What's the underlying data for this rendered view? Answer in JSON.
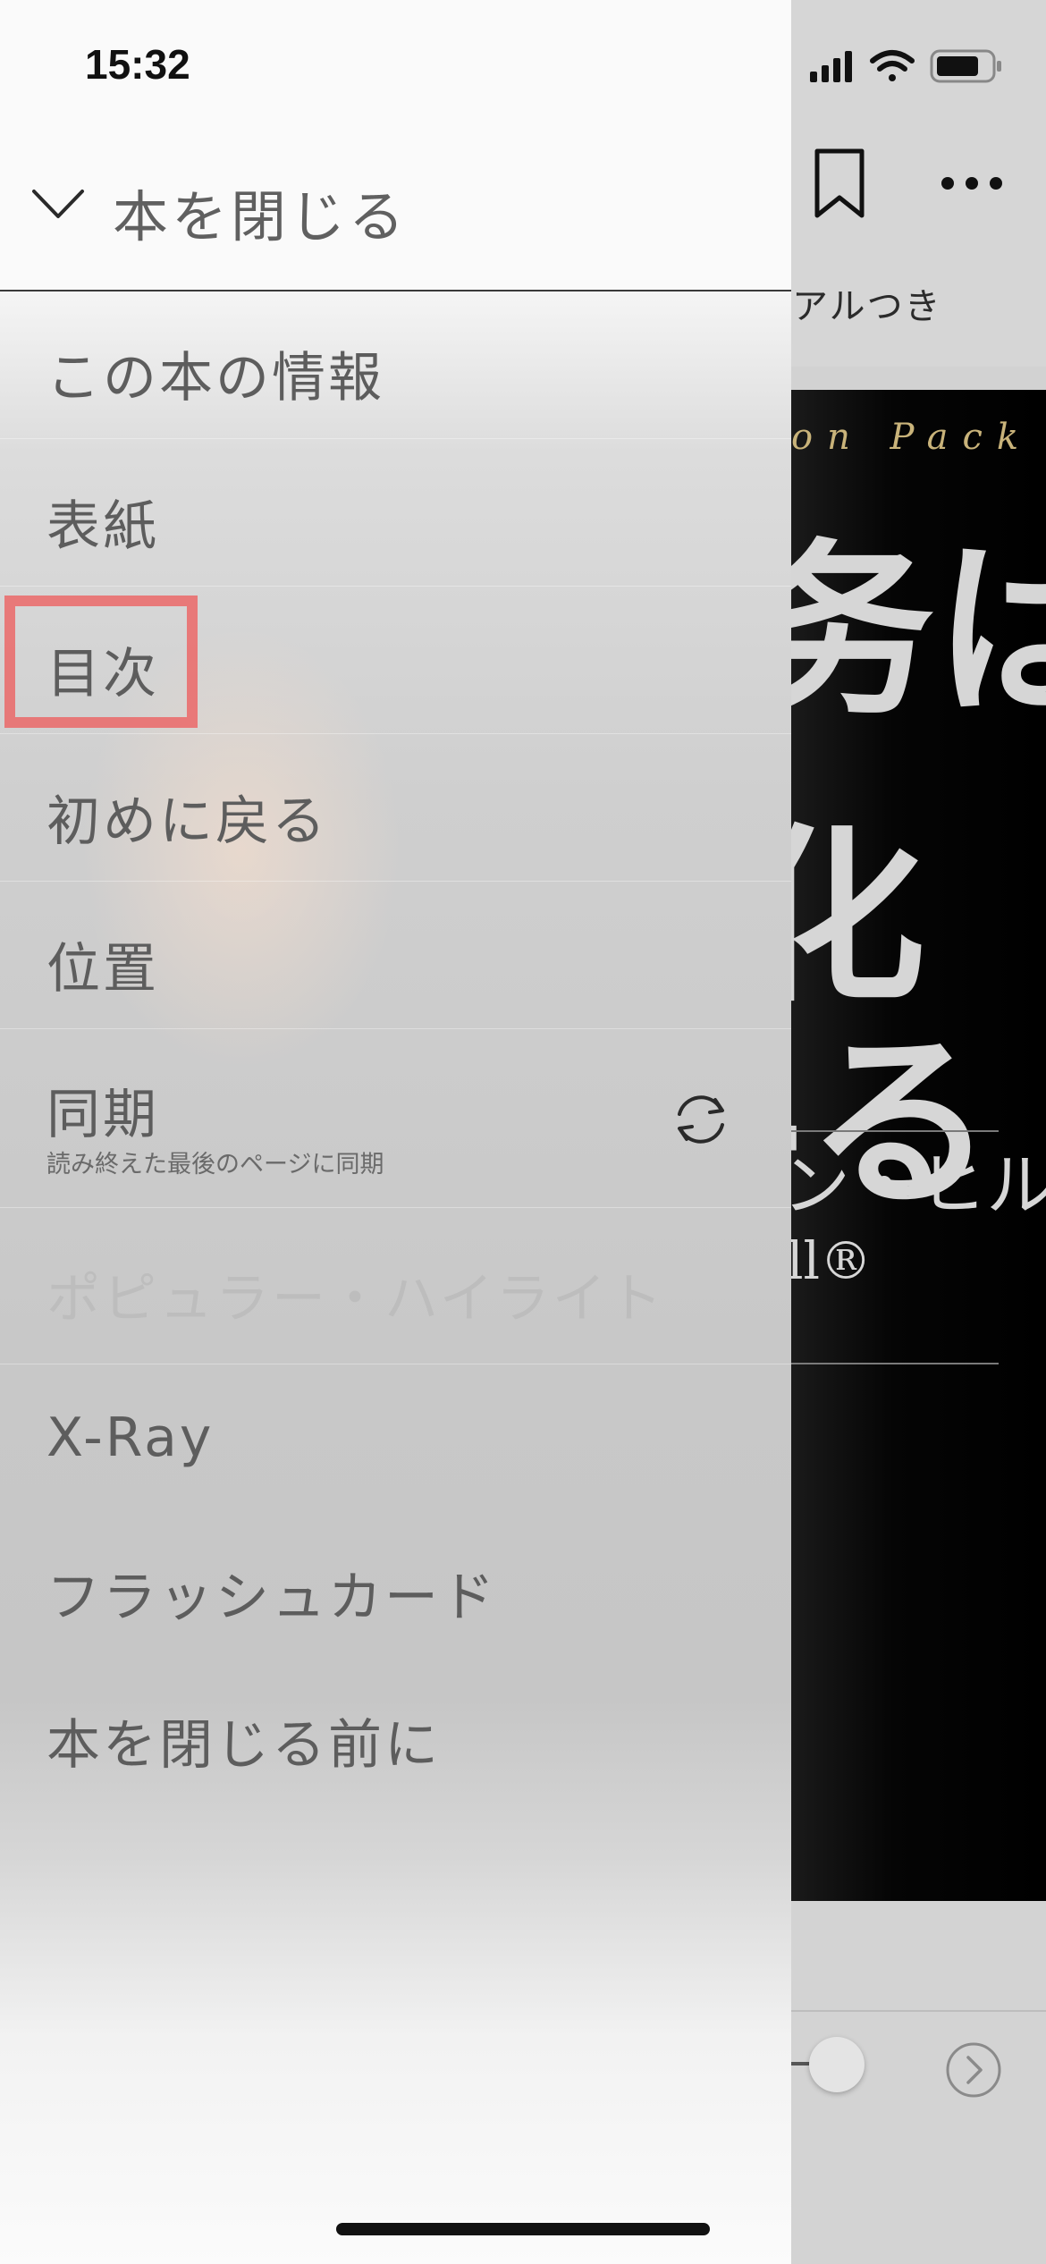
{
  "status_bar": {
    "time": "15:32"
  },
  "reader": {
    "subtitle_fragment": "アルつき",
    "cover": {
      "series_fragment": "on Pack",
      "title_lines": [
        "务は",
        "化",
        "-る"
      ],
      "author_fragment": "ン・ヒル",
      "author_en_fragment": "ll®"
    }
  },
  "drawer": {
    "close_label": "本を閉じる",
    "items": [
      {
        "label": "この本の情報"
      },
      {
        "label": "表紙"
      },
      {
        "label": "目次"
      },
      {
        "label": "初めに戻る"
      },
      {
        "label": "位置"
      },
      {
        "label": "同期",
        "sublabel": "読み終えた最後のページに同期"
      },
      {
        "label": "ポピュラー・ハイライト",
        "disabled": true
      },
      {
        "label": "X-Ray"
      },
      {
        "label": "フラッシュカード"
      },
      {
        "label": "本を閉じる前に"
      }
    ]
  },
  "colors": {
    "highlight": "#ee5a5a",
    "drawer_text": "#5d5d5d",
    "disabled_text": "#bdbdbd",
    "cover_gold": "#c9b37a"
  },
  "icons": [
    "chevron-down-icon",
    "sync-icon",
    "bookmark-icon",
    "more-icon",
    "next-page-icon",
    "signal-icon",
    "wifi-icon",
    "battery-icon"
  ]
}
